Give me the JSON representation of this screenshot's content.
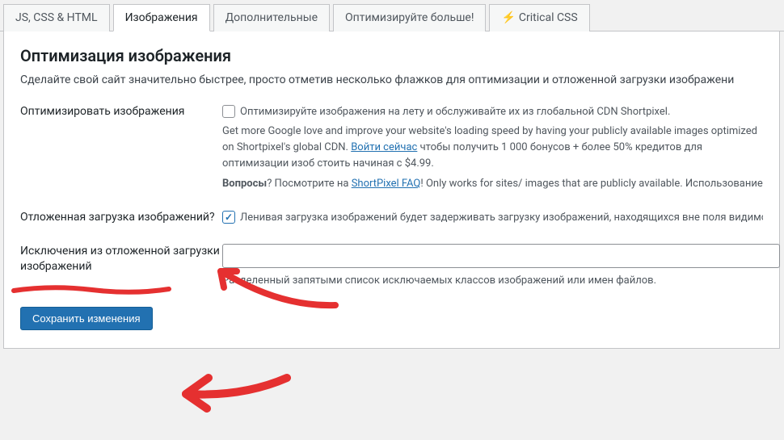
{
  "tabs": [
    {
      "label": "JS, CSS & HTML"
    },
    {
      "label": "Изображения"
    },
    {
      "label": "Дополнительные"
    },
    {
      "label": "Оптимизируйте больше!"
    },
    {
      "label": "Critical CSS"
    }
  ],
  "section": {
    "heading": "Оптимизация изображения",
    "intro": "Сделайте свой сайт значительно быстрее, просто отметив несколько флажков для оптимизации и отложенной загрузки изображени"
  },
  "optimize": {
    "label": "Оптимизировать изображения",
    "checkbox_text": "Оптимизируйте изображения на лету и обслуживайте их из глобальной CDN Shortpixel.",
    "desc1": "Get more Google love and improve your website's loading speed by having your publicly available images optimized on Shortpixel's global CDN. ",
    "login_link": "Войти сейчас",
    "desc2": " чтобы получить 1 000 бонусов + более 50% кредитов для оптимизации изоб стоить начиная с $4.99.",
    "q_label": "Вопросы",
    "q_text": "? Посмотрите на ",
    "faq_link": "ShortPixel FAQ",
    "q_after": "! Only works for sites/ images that are publicly available. Использование это"
  },
  "lazy": {
    "label": "Отложенная загрузка изображений?",
    "checkbox_text": "Ленивая загрузка изображений будет задерживать загрузку изображений, находящихся вне поля видимости д"
  },
  "exclude": {
    "label": "Исключения из отложенной загрузки изображений",
    "value": "",
    "help": "Разделенный запятыми список исключаемых классов изображений или имен файлов."
  },
  "submit": {
    "label": "Сохранить изменения"
  }
}
